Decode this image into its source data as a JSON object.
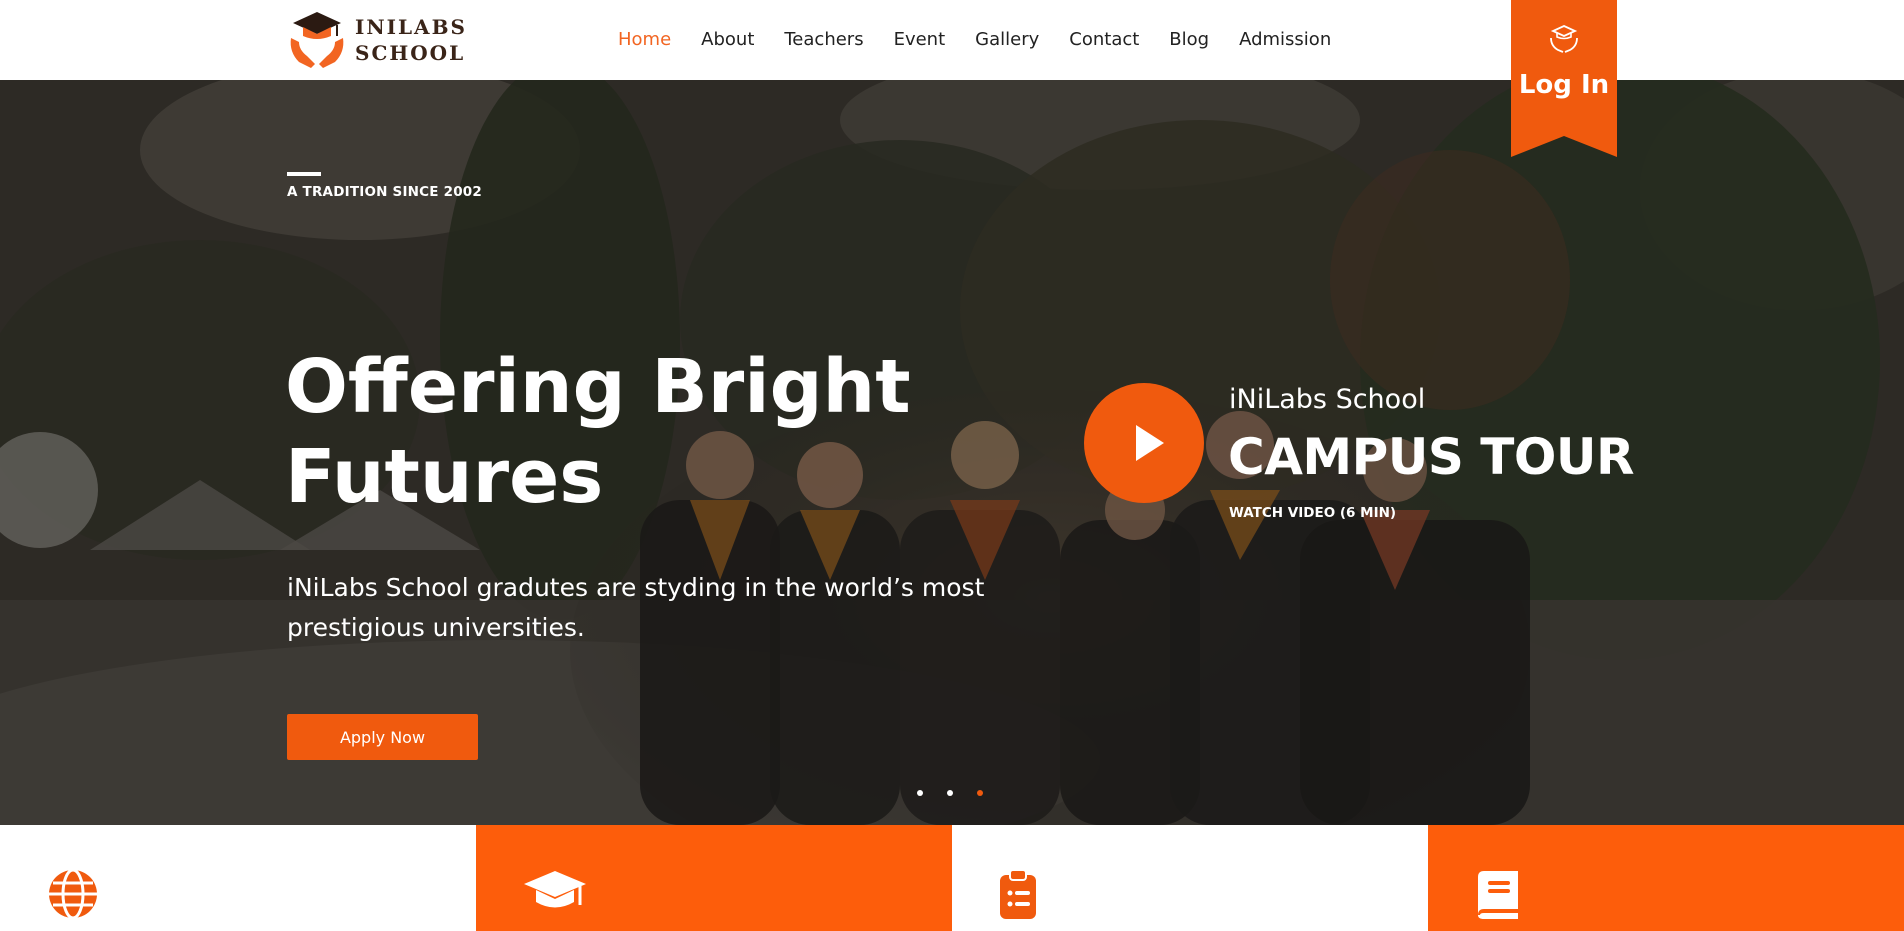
{
  "brand": {
    "line1": "INILABS",
    "line2": "SCHOOL",
    "accent": "#f26522",
    "dark": "#3a2418"
  },
  "nav": {
    "items": [
      {
        "label": "Home",
        "active": true
      },
      {
        "label": "About"
      },
      {
        "label": "Teachers"
      },
      {
        "label": "Event"
      },
      {
        "label": "Gallery"
      },
      {
        "label": "Contact"
      },
      {
        "label": "Blog"
      },
      {
        "label": "Admission"
      }
    ]
  },
  "login": {
    "label": "Log In",
    "icon": "graduation-hands-icon"
  },
  "hero": {
    "eyebrow": "A TRADITION SINCE 2002",
    "headline_line1": "Offering Bright",
    "headline_line2": "Futures",
    "subtext_line1": "iNiLabs School gradutes are styding in the world’s most",
    "subtext_line2": "prestigious universities.",
    "apply_label": "Apply Now",
    "carousel": {
      "slides": 3,
      "active": 3
    }
  },
  "tour": {
    "school": "iNiLabs School",
    "title": "CAMPUS TOUR",
    "watch": "WATCH VIDEO (6 MIN)",
    "icon": "play-icon"
  },
  "features": [
    {
      "icon": "globe-icon",
      "style": "white"
    },
    {
      "icon": "graduation-cap-icon",
      "style": "orange"
    },
    {
      "icon": "clipboard-list-icon",
      "style": "white"
    },
    {
      "icon": "book-icon",
      "style": "orange"
    }
  ],
  "colors": {
    "accent": "#f05a0e",
    "feature_orange": "#fd5d0b",
    "text_white": "#ffffff"
  }
}
